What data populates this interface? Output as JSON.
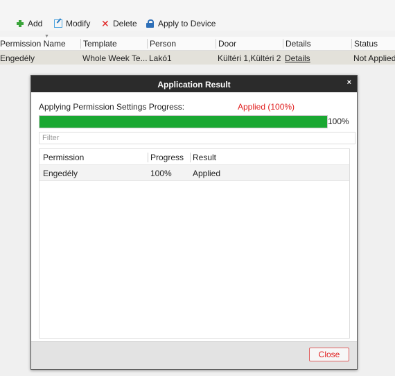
{
  "toolbar": {
    "add_label": "Add",
    "modify_label": "Modify",
    "delete_label": "Delete",
    "apply_label": "Apply to Device"
  },
  "table": {
    "columns": [
      "Permission Name",
      "Template",
      "Person",
      "Door",
      "Details",
      "Status"
    ],
    "rows": [
      {
        "permission_name": "Engedély",
        "template": "Whole Week Te...",
        "person": "Lakó1",
        "door": "Kültéri 1,Kültéri 2",
        "details": "Details",
        "status": "Not Applied"
      }
    ]
  },
  "dialog": {
    "title": "Application Result",
    "close_x": "×",
    "progress_label": "Applying Permission Settings Progress:",
    "progress_status": "Applied (100%)",
    "progress_value": 1.0,
    "progress_percent_text": "100%",
    "filter_placeholder": "Filter",
    "columns": [
      "Permission",
      "Progress",
      "Result"
    ],
    "rows": [
      {
        "permission": "Engedély",
        "progress": "100%",
        "result": "Applied"
      }
    ],
    "close_button": "Close"
  },
  "colors": {
    "progress_fill": "#1aa832",
    "status_red": "#e02020",
    "title_bar": "#2b2b2b"
  }
}
